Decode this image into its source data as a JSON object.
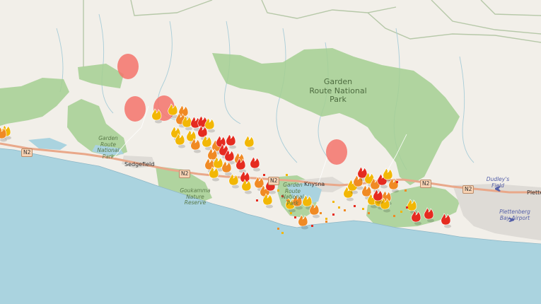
{
  "map": {
    "labels": {
      "garden_route_np": "Garden\nRoute National\nPark",
      "garden_route_np_west": "Garden\nRoute\nNational\nPark",
      "garden_route_np_knysna": "Garden\nRoute\nNational\nPark",
      "goukamma": "Goukamma\nNature\nReserve",
      "sedgefield": "Sedgefield",
      "knysna": "Knysna",
      "dudleys_field": "Dudley's\nField",
      "plettenberg_airport": "Plettenberg\nBay Airport",
      "plettenberg_town": "Plette",
      "n2_a": "N2",
      "n2_b": "N2",
      "n2_c": "N2",
      "n2_d": "N2",
      "n2_e": "N2"
    },
    "colors": {
      "land": "#f2efe9",
      "sea": "#aad3df",
      "park": "#9fc98a",
      "road": "#e9a88a",
      "fire_yellow": "#f2b705",
      "fire_orange": "#f08a24",
      "fire_red": "#e52b20",
      "heat_circle": "#f4736b"
    },
    "icons": [
      "fire-icon",
      "airport-icon",
      "road-shield-icon"
    ]
  }
}
